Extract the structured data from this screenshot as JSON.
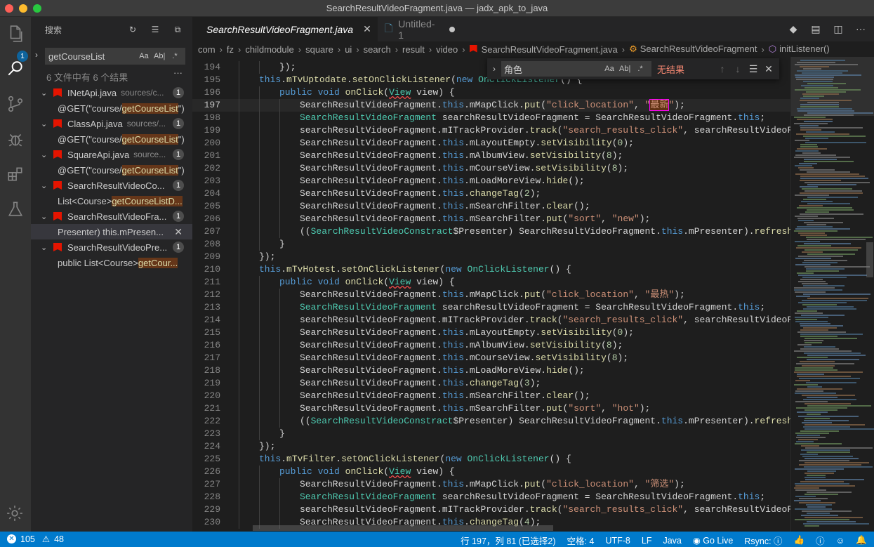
{
  "window": {
    "title": "SearchResultVideoFragment.java — jadx_apk_to_java",
    "traffic_colors": [
      "#ff5f57",
      "#febc2e",
      "#28c840"
    ]
  },
  "activity_bar": {
    "explorer_badge": "1",
    "icons": [
      "files-icon",
      "search-icon",
      "source-control-icon",
      "debug-icon",
      "extensions-icon",
      "testing-icon"
    ]
  },
  "sidebar": {
    "title": "搜索",
    "search_value": "getCourseList",
    "options": [
      "Aa",
      "Ab|",
      ".*"
    ],
    "summary": "6 文件中有 6 个结果",
    "results": [
      {
        "file": "INetApi.java",
        "path": "sources/c...",
        "count": "1",
        "match_pre": "@GET(\"course/",
        "match_hl": "getCourseList",
        "match_post": "\")"
      },
      {
        "file": "ClassApi.java",
        "path": "sources/...",
        "count": "1",
        "match_pre": "@GET(\"course/",
        "match_hl": "getCourseList",
        "match_post": "\")"
      },
      {
        "file": "SquareApi.java",
        "path": "source...",
        "count": "1",
        "match_pre": "@GET(\"course/",
        "match_hl": "getCourseList",
        "match_post": "\")"
      },
      {
        "file": "SearchResultVideoCo...",
        "path": "",
        "count": "1",
        "match_pre": "List<Course> ",
        "match_hl": "getCourseListD...",
        "match_post": ""
      },
      {
        "file": "SearchResultVideoFra...",
        "path": "",
        "count": "1",
        "match_pre": "Presenter) this.mPresen...",
        "match_hl": "",
        "match_post": ""
      },
      {
        "file": "SearchResultVideoPre...",
        "path": "",
        "count": "1",
        "match_pre": "public List<Course> ",
        "match_hl": "getCour...",
        "match_post": ""
      }
    ]
  },
  "tabs": [
    {
      "label": "SearchResultVideoFragment.java",
      "active": true
    },
    {
      "label": "Untitled-1",
      "active": false
    }
  ],
  "breadcrumbs": [
    "com",
    "fz",
    "childmodule",
    "square",
    "ui",
    "search",
    "result",
    "video",
    "SearchResultVideoFragment.java",
    "SearchResultVideoFragment",
    "initListener()"
  ],
  "find_widget": {
    "value": "角色",
    "options": [
      "Aa",
      "Ab|",
      ".*"
    ],
    "result": "无结果"
  },
  "editor": {
    "current_line": 197,
    "first_line": 194
  },
  "status_bar": {
    "errors": "105",
    "warnings": "48",
    "position": "行 197，列 81 (已选择2)",
    "spaces": "空格: 4",
    "encoding": "UTF-8",
    "eol": "LF",
    "language": "Java",
    "golive": "Go Live",
    "rsync": "Rsync:"
  }
}
